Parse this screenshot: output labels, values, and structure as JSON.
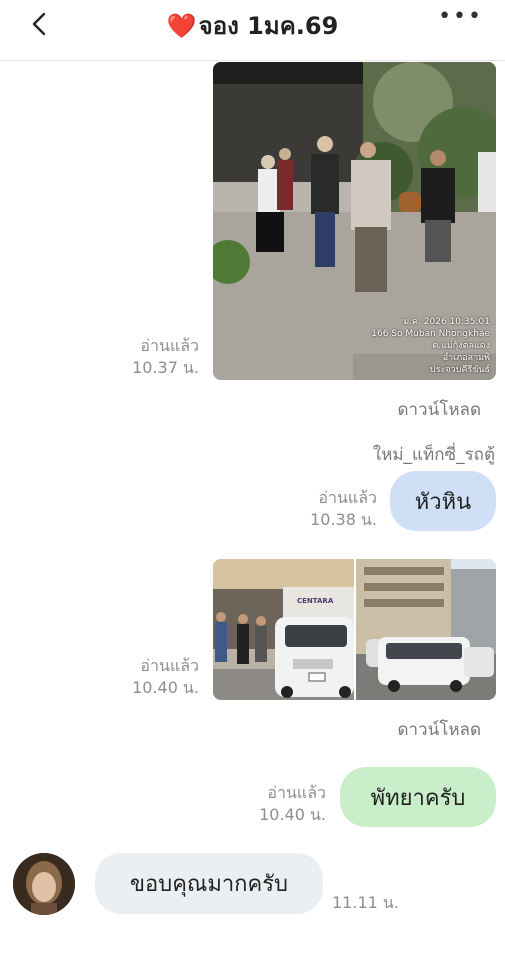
{
  "header": {
    "title": "จอง 1มค.69",
    "heart": "❤️"
  },
  "messages": {
    "photo1": {
      "read": "อ่านแล้ว",
      "time": "10.37 น.",
      "stamp_lines": [
        "ม.ค. 2026 10:35:01",
        "166 So Muban Nhongkhae",
        "ต.แม่กุ้งตลแดง",
        "อำเภอสามพิ",
        "ประจวบคีรีขันธ์"
      ],
      "download": "ดาวน์โหลด"
    },
    "msg_huahin": {
      "sender_label": "ใหม่_แท็กซี่_รถตู้",
      "read": "อ่านแล้ว",
      "time": "10.38 น.",
      "text": "หัวหิน"
    },
    "photo2": {
      "read": "อ่านแล้ว",
      "time": "10.40 น.",
      "sign": "CENTARA",
      "download": "ดาวน์โหลด"
    },
    "msg_pattaya": {
      "read": "อ่านแล้ว",
      "time": "10.40 น.",
      "text": "พัทยาครับ"
    },
    "msg_thanks": {
      "text": "ขอบคุณมากครับ",
      "time": "11.11 น."
    }
  },
  "colors": {
    "bubble_blue": "#cfdff6",
    "bubble_green": "#c9eec9",
    "bubble_gray": "#eceff1",
    "heart": "#e01b2b"
  },
  "icons": [
    "back-chevron-icon",
    "more-dots-icon"
  ]
}
